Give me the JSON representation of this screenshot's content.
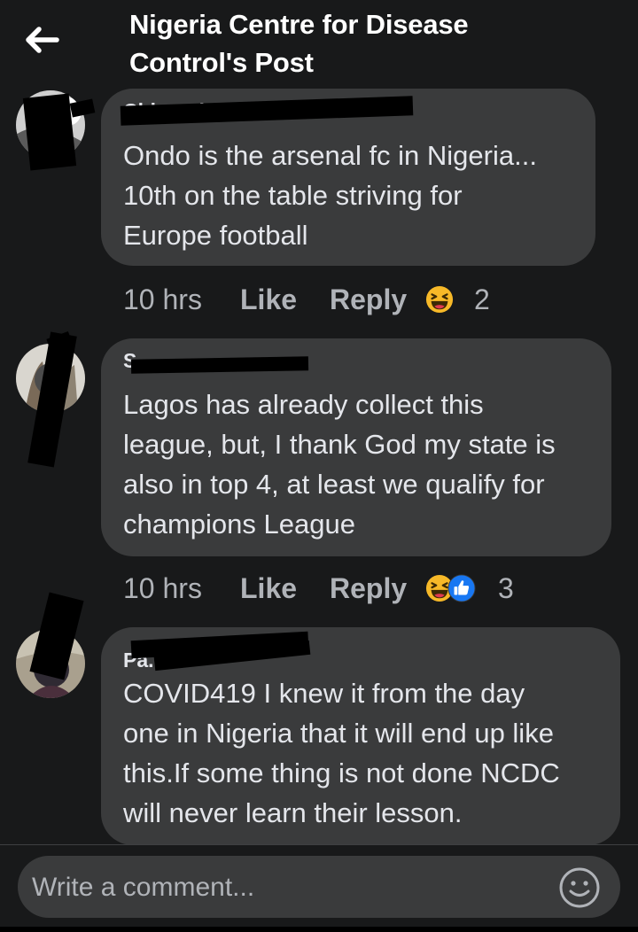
{
  "header": {
    "title_line1": "Nigeria Centre for Disease",
    "title_line2": "Control's Post"
  },
  "comments": [
    {
      "author": "Chinmulewe K...",
      "lines": [
        "Ondo is the arsenal fc in Nigeria...",
        "10th on the table striving for",
        "Europe football"
      ],
      "time": "10 hrs",
      "like_label": "Like",
      "reply_label": "Reply",
      "reactions": [
        "laughing-emoji-icon"
      ],
      "reaction_count": "2"
    },
    {
      "author": "S...",
      "lines": [
        "Lagos has already collect this",
        "league, but, I thank God my state is",
        "also in top 4, at least we qualify for",
        "champions League"
      ],
      "time": "10 hrs",
      "like_label": "Like",
      "reply_label": "Reply",
      "reactions": [
        "laughing-emoji-icon",
        "thumbs-up-icon"
      ],
      "reaction_count": "3"
    },
    {
      "author": "Pa...",
      "lines": [
        "COVID419 I knew it from the day",
        "one in Nigeria that it will end up like",
        "this.If some thing is not done NCDC",
        "will never learn their lesson."
      ]
    }
  ],
  "composer": {
    "placeholder": "Write a comment..."
  },
  "colors": {
    "background": "#18191a",
    "bubble": "#3a3b3c",
    "primary_text": "#e4e6eb",
    "secondary_text": "#b0b3b8",
    "like_blue": "#1877f2",
    "haha_yellow": "#f7b928"
  }
}
